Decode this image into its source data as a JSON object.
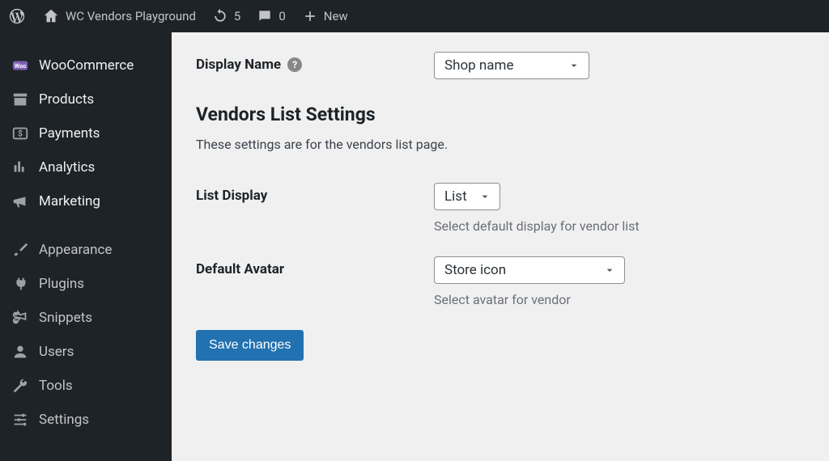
{
  "adminbar": {
    "site_title": "WC Vendors Playground",
    "updates": "5",
    "comments": "0",
    "new_label": "New"
  },
  "sidebar": {
    "items": [
      {
        "icon": "woocommerce",
        "label": "WooCommerce"
      },
      {
        "icon": "products",
        "label": "Products"
      },
      {
        "icon": "payments",
        "label": "Payments"
      },
      {
        "icon": "analytics",
        "label": "Analytics"
      },
      {
        "icon": "marketing",
        "label": "Marketing"
      },
      {
        "sep": true
      },
      {
        "icon": "appearance",
        "label": "Appearance"
      },
      {
        "icon": "plugins",
        "label": "Plugins"
      },
      {
        "icon": "snippets",
        "label": "Snippets"
      },
      {
        "icon": "users",
        "label": "Users"
      },
      {
        "icon": "tools",
        "label": "Tools"
      },
      {
        "icon": "settings",
        "label": "Settings"
      }
    ]
  },
  "form": {
    "display_name": {
      "label": "Display Name",
      "value": "Shop name"
    },
    "section_title": "Vendors List Settings",
    "section_desc": "These settings are for the vendors list page.",
    "list_display": {
      "label": "List Display",
      "value": "List",
      "help": "Select default display for vendor list"
    },
    "default_avatar": {
      "label": "Default Avatar",
      "value": "Store icon",
      "help": "Select avatar for vendor"
    },
    "save_label": "Save changes"
  }
}
